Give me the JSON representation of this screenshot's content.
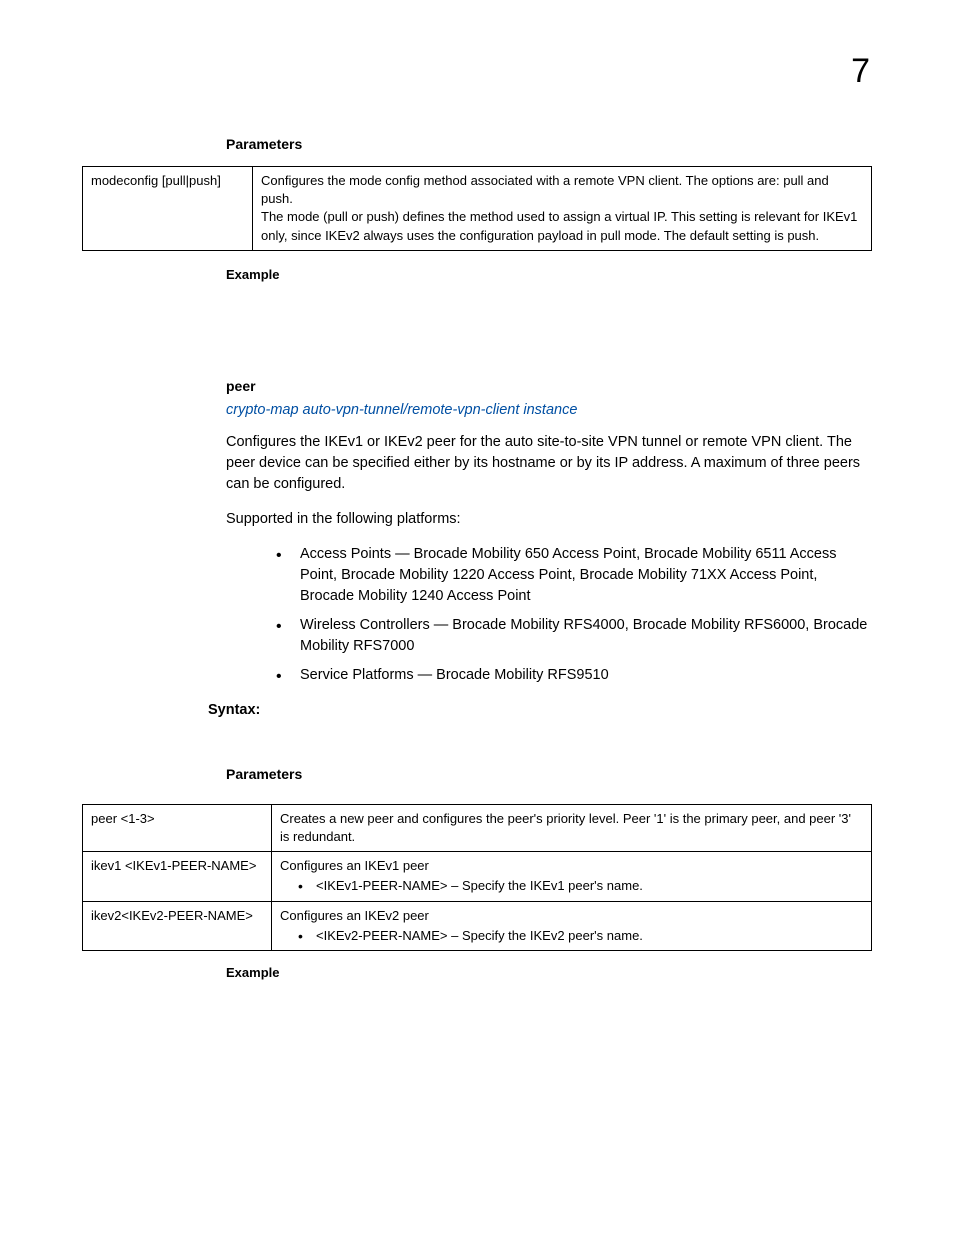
{
  "pageNumber": "7",
  "section1": {
    "parametersHeading": "Parameters",
    "table": {
      "key": "modeconfig [pull|push]",
      "val1": "Configures the mode config method associated with a remote VPN client. The options are: pull and push.",
      "val2": "The mode (pull or push) defines the method used to assign a virtual IP. This setting is relevant for IKEv1 only, since IKEv2 always uses the configuration payload in pull mode. The default setting is push."
    },
    "exampleHeading": "Example"
  },
  "section2": {
    "peerHeading": "peer",
    "link": "crypto-map auto-vpn-tunnel/remote-vpn-client instance",
    "intro": "Configures the IKEv1 or IKEv2 peer for the auto site-to-site VPN tunnel or remote VPN client. The peer device can be specified either by its hostname or by its IP address. A maximum of three peers can be configured.",
    "supported": "Supported in the following platforms:",
    "bullets": [
      "Access Points — Brocade Mobility 650 Access Point, Brocade Mobility 6511 Access Point, Brocade Mobility 1220 Access Point, Brocade Mobility 71XX Access Point, Brocade Mobility 1240 Access Point",
      "Wireless Controllers — Brocade Mobility RFS4000, Brocade Mobility RFS6000, Brocade Mobility RFS7000",
      "Service Platforms — Brocade Mobility RFS9510"
    ],
    "syntaxHeading": "Syntax:",
    "parametersHeading": "Parameters",
    "table": {
      "rows": [
        {
          "key": "peer <1-3>",
          "desc": "Creates a new peer and configures the peer's priority level. Peer '1' is the primary peer, and peer '3' is redundant."
        },
        {
          "key": "ikev1 <IKEv1-PEER-NAME>",
          "desc": "Configures an IKEv1 peer",
          "sub": "<IKEv1-PEER-NAME> – Specify the IKEv1 peer's name."
        },
        {
          "key": "ikev2<IKEv2-PEER-NAME>",
          "desc": "Configures an IKEv2 peer",
          "sub": "<IKEv2-PEER-NAME> – Specify the IKEv2 peer's name."
        }
      ]
    },
    "exampleHeading": "Example"
  }
}
